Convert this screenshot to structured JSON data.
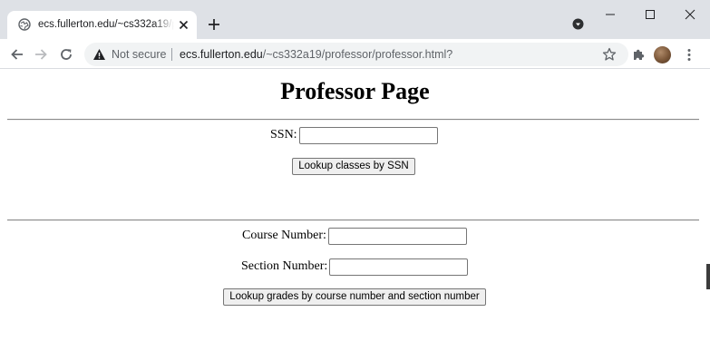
{
  "browser": {
    "tab_title": "ecs.fullerton.edu/~cs332a19/professor/professor.html?",
    "security_label": "Not secure",
    "url_host": "ecs.fullerton.edu",
    "url_path": "/~cs332a19/professor/professor.html?",
    "icons": [
      "globe-icon",
      "close-icon",
      "plus-icon",
      "back-arrow-icon",
      "forward-arrow-icon",
      "reload-icon",
      "warning-icon",
      "star-icon",
      "puzzle-icon",
      "kebab-menu-icon"
    ]
  },
  "page": {
    "title": "Professor Page",
    "ssn_label": "SSN:",
    "ssn_value": "",
    "ssn_button": "Lookup classes by SSN",
    "course_label": "Course Number:",
    "course_value": "",
    "section_label": "Section Number:",
    "section_value": "",
    "grades_button": "Lookup grades by course number and section number"
  }
}
